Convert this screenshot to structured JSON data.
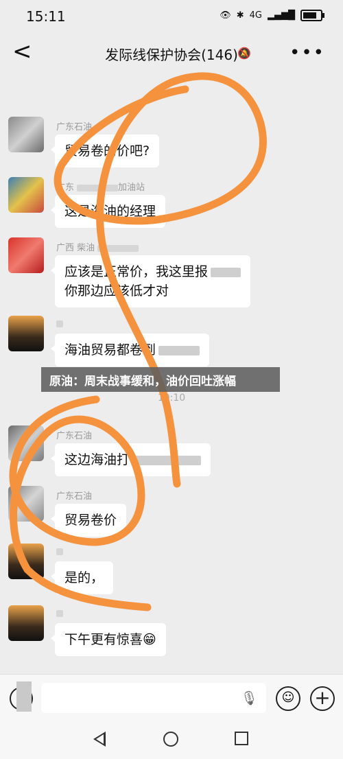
{
  "status": {
    "time": "15:11",
    "network": "4G",
    "battery_level": 0.85
  },
  "header": {
    "back_label": "<",
    "title": "发际线保护协会(146)",
    "more_label": "•••"
  },
  "timestamps": [
    "10:10"
  ],
  "messages": [
    {
      "sender": "广东石油",
      "text": "贸易卷的价吧?"
    },
    {
      "sender": "广东",
      "sender_tail": "加油站",
      "text": "这是海油的经理"
    },
    {
      "sender": "广西 柴油",
      "line1": "应该是正常价，我这里报",
      "line2": "你那边应该低才对"
    },
    {
      "sender": "",
      "text": "海油贸易都卷到"
    },
    {
      "sender": "广东石油",
      "text": "这边海油打"
    },
    {
      "sender": "广东石油",
      "text": "贸易卷价"
    },
    {
      "sender": "",
      "text": "是的，"
    },
    {
      "sender": "",
      "text": "下午更有惊喜😁"
    }
  ],
  "overlay_caption": "原油：周末战事缓和，油价回吐涨幅",
  "colors": {
    "annotation": "#f5923e",
    "background": "#ededed",
    "bubble": "#ffffff"
  }
}
